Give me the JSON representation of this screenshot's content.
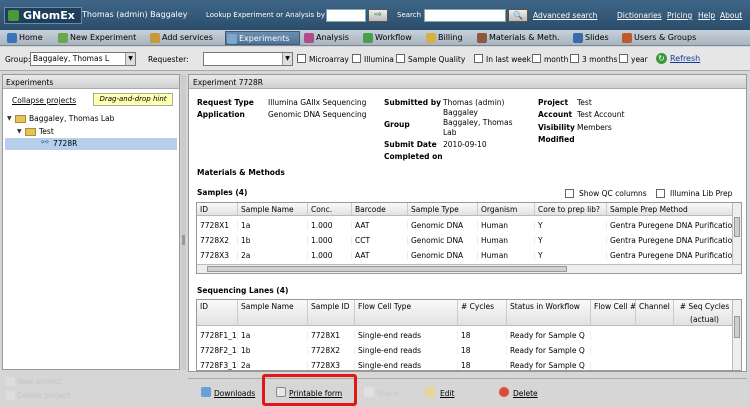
{
  "topbar": {
    "logo": "GNomEx",
    "user": "Thomas (admin) Baggaley",
    "lookup_label": "Lookup Experiment or Analysis by #",
    "lookup_go": "⇨",
    "search_label": "Search",
    "search_icon": "🔍",
    "advanced_search": "Advanced search",
    "links": [
      "Dictionaries",
      "Pricing",
      "Help",
      "About"
    ]
  },
  "nav": [
    {
      "label": "Home",
      "icon": "home-icon",
      "color": "#3a73b8"
    },
    {
      "label": "New Experiment",
      "icon": "new-experiment-icon",
      "color": "#6aa84f"
    },
    {
      "label": "Add services",
      "icon": "add-services-icon",
      "color": "#c69a3a"
    },
    {
      "label": "Experiments",
      "icon": "experiments-icon",
      "color": "#7fa6cc"
    },
    {
      "label": "Analysis",
      "icon": "analysis-icon",
      "color": "#b04a8a"
    },
    {
      "label": "Workflow",
      "icon": "workflow-icon",
      "color": "#4aa04a"
    },
    {
      "label": "Billing",
      "icon": "billing-icon",
      "color": "#d4b046"
    },
    {
      "label": "Materials & Meth.",
      "icon": "materials-icon",
      "color": "#8a5a3a"
    },
    {
      "label": "Slides",
      "icon": "slides-icon",
      "color": "#3a6aa8"
    },
    {
      "label": "Users & Groups",
      "icon": "users-icon",
      "color": "#c05a2a"
    }
  ],
  "filter": {
    "group_label": "Group:",
    "group_value": "Baggaley, Thomas L",
    "requester_label": "Requester:",
    "requester_value": "",
    "checkboxes": [
      "Microarray",
      "Illumina",
      "Sample Quality",
      "In last week",
      "month",
      "3 months",
      "year"
    ],
    "refresh": "Refresh"
  },
  "left": {
    "header": "Experiments",
    "collapse": "Collapse projects",
    "hint": "Drag-and-drop hint",
    "tree": [
      {
        "label": "Baggaley, Thomas Lab",
        "twist": "▼"
      },
      {
        "label": "Test",
        "twist": "▼"
      },
      {
        "label": "7728R",
        "twist": ""
      }
    ],
    "footer": [
      "New project",
      "Delete project"
    ]
  },
  "experiment": {
    "title": "Experiment 7728R",
    "request_type_label": "Request Type",
    "request_type": "Illumina GAIIx Sequencing",
    "application_label": "Application",
    "application": "Genomic DNA Sequencing",
    "submitted_by_label": "Submitted by",
    "submitted_by": "Thomas (admin) Baggaley",
    "group_label": "Group",
    "group": "Baggaley, Thomas Lab",
    "submit_date_label": "Submit Date",
    "submit_date": "2010-09-10",
    "completed_label": "Completed on",
    "project_label": "Project",
    "project": "Test",
    "account_label": "Account",
    "account": "Test Account",
    "visibility_label": "Visibility",
    "visibility": "Members",
    "modified_label": "Modified",
    "materials_methods": "Materials & Methods"
  },
  "samples": {
    "title": "Samples (4)",
    "show_qc": "Show QC columns",
    "illumina_lib": "Illumina Lib Prep",
    "columns": [
      "ID",
      "Sample Name",
      "Conc.",
      "Barcode",
      "Sample Type",
      "Organism",
      "Core to prep lib?",
      "Sample Prep Method"
    ],
    "rows": [
      [
        "7728X1",
        "1a",
        "1.000",
        "AAT",
        "Genomic DNA",
        "Human",
        "Y",
        "Gentra Puregene DNA Purificatio"
      ],
      [
        "7728X2",
        "1b",
        "1.000",
        "CCT",
        "Genomic DNA",
        "Human",
        "Y",
        "Gentra Puregene DNA Purificatio"
      ],
      [
        "7728X3",
        "2a",
        "1.000",
        "AAT",
        "Genomic DNA",
        "Human",
        "Y",
        "Gentra Puregene DNA Purificatio"
      ]
    ]
  },
  "lanes": {
    "title": "Sequencing Lanes (4)",
    "columns": [
      "ID",
      "Sample Name",
      "Sample ID",
      "Flow Cell Type",
      "# Cycles",
      "Status in Workflow",
      "Flow Cell #",
      "Channel",
      "# Seq Cycles (actual)"
    ],
    "rows": [
      [
        "7728F1_1",
        "1a",
        "7728X1",
        "Single-end reads",
        "18",
        "Ready for Sample Q",
        "",
        "",
        ""
      ],
      [
        "7728F2_1",
        "1b",
        "7728X2",
        "Single-end reads",
        "18",
        "Ready for Sample Q",
        "",
        "",
        ""
      ],
      [
        "7728F3_1",
        "2a",
        "7728X3",
        "Single-end reads",
        "18",
        "Ready for Sample Q",
        "",
        "",
        ""
      ]
    ]
  },
  "actions": {
    "downloads": "Downloads",
    "printable": "Printable form",
    "share": "Share",
    "edit": "Edit",
    "delete": "Delete"
  }
}
